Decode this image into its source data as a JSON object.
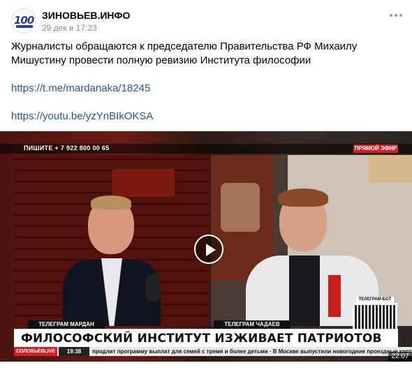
{
  "post": {
    "author": "ЗИНОВЬЕВ.ИНФО",
    "avatar_text": "100",
    "date": "29 дек в 17:23",
    "text_lines": [
      "Журналисты обращаются к председателю Правительства РФ Михаилу",
      "Мишустину провести полную ревизию Института философии"
    ],
    "link1": "https://t.me/mardanaka/18245",
    "link2": "https://youtu.be/yzYnBIkOKSA"
  },
  "video": {
    "phone": "ПИШИТЕ  + 7 922 800 00 65",
    "live_badge": "ПРЯМОЙ ЭФИР",
    "name_left": "ТЕЛЕГРАМ МАРДАН",
    "name_right": "ТЕЛЕГРАМ ЧАДАЕВ",
    "headline": "ФИЛОСОФСКИЙ ИНСТИТУТ ИЗЖИВАЕТ ПАТРИОТОВ",
    "ticker_logo": "СОЛОВЬЁВLIVE",
    "ticker_time": "19:38",
    "ticker_text": "продлит программу выплат для семей с тремя и более детьми · В Москве выпустили новогодние проездные карты",
    "qr_label": "ТЕЛЕГРАМ-БОТ",
    "duration": "22:07"
  },
  "icons": {
    "more": "more-dots-icon",
    "play": "play-icon"
  },
  "colors": {
    "link": "#2a5885",
    "date": "#818c99",
    "live": "#d41f26"
  }
}
